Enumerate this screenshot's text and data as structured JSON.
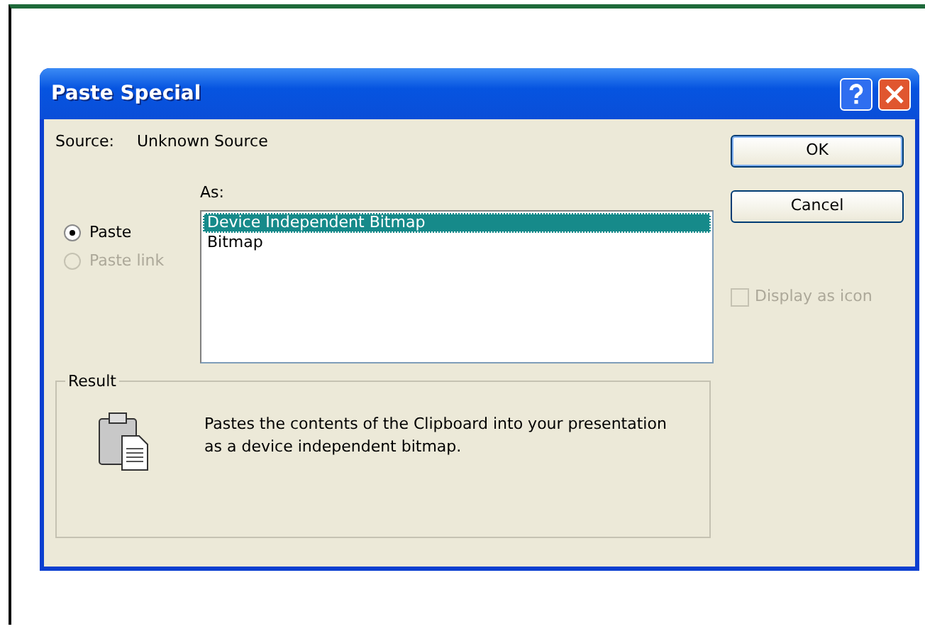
{
  "window": {
    "title": "Paste Special"
  },
  "source": {
    "label": "Source:",
    "value": "Unknown Source"
  },
  "options": [
    {
      "label": "Paste",
      "selected": true,
      "disabled": false
    },
    {
      "label": "Paste link",
      "selected": false,
      "disabled": true
    }
  ],
  "as_list": {
    "label": "As:",
    "items": [
      {
        "label": "Device Independent Bitmap",
        "selected": true
      },
      {
        "label": "Bitmap",
        "selected": false
      }
    ]
  },
  "result": {
    "label": "Result",
    "description": "Pastes the contents of the Clipboard into your presentation as a device independent bitmap."
  },
  "buttons": [
    "OK",
    "Cancel"
  ],
  "display_as_icon": {
    "label": "Display as icon",
    "checked": false,
    "disabled": true
  }
}
